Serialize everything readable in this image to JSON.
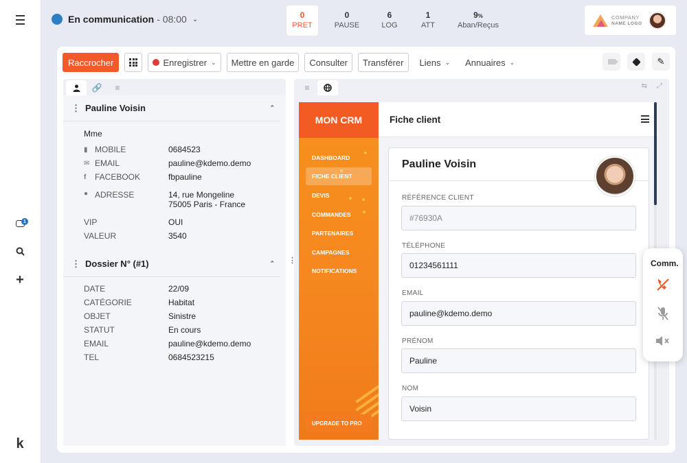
{
  "status": {
    "label": "En communication",
    "time": "- 08:00"
  },
  "counters": [
    {
      "num": "0",
      "label": "PRET"
    },
    {
      "num": "0",
      "label": "PAUSE"
    },
    {
      "num": "6",
      "label": "LOG"
    },
    {
      "num": "1",
      "label": "ATT"
    },
    {
      "num": "9",
      "pct": "%",
      "label": "Aban/Reçus"
    }
  ],
  "company": {
    "line1": "COMPANY",
    "line2": "NAME LOGO"
  },
  "rail": {
    "badge": "1",
    "logo": "k"
  },
  "toolbar": {
    "hangup": "Raccrocher",
    "record": "Enregistrer",
    "hold": "Mettre en garde",
    "consult": "Consulter",
    "transfer": "Transférer",
    "links": "Liens",
    "directories": "Annuaires"
  },
  "contact": {
    "name": "Pauline Voisin",
    "title": "Mme",
    "fields": [
      {
        "label": "MOBILE",
        "value": "0684523"
      },
      {
        "label": "EMAIL",
        "value": "pauline@kdemo.demo"
      },
      {
        "label": "FACEBOOK",
        "value": "fbpauline"
      },
      {
        "label": "ADRESSE",
        "value": "14, rue Mongeline",
        "value2": "75005 Paris - France"
      },
      {
        "label": "VIP",
        "value": "OUI"
      },
      {
        "label": "VALEUR",
        "value": "3540"
      }
    ]
  },
  "dossier": {
    "title": "Dossier N° (#1)",
    "fields": [
      {
        "label": "DATE",
        "value": "22/09"
      },
      {
        "label": "CATÉGORIE",
        "value": "Habitat"
      },
      {
        "label": "OBJET",
        "value": "Sinistre"
      },
      {
        "label": "STATUT",
        "value": "En cours"
      },
      {
        "label": "EMAIL",
        "value": "pauline@kdemo.demo"
      },
      {
        "label": "TEL",
        "value": "0684523215"
      }
    ]
  },
  "crm": {
    "brand": "MON CRM",
    "nav": [
      "DASHBOARD",
      "FICHE CLIENT",
      "DEVIS",
      "COMMANDES",
      "PARTENAIRES",
      "CAMPAGNES",
      "NOTIFICATIONS"
    ],
    "upgrade": "UPGRADE TO PRO",
    "page_title": "Fiche client",
    "client_name": "Pauline Voisin",
    "fields": [
      {
        "label": "RÉFÉRENCE CLIENT",
        "value": "#76930A"
      },
      {
        "label": "TÉLÉPHONE",
        "value": "01234561111"
      },
      {
        "label": "EMAIL",
        "value": "pauline@kdemo.demo"
      },
      {
        "label": "PRÉNOM",
        "value": "Pauline"
      },
      {
        "label": "NOM",
        "value": "Voisin"
      }
    ]
  },
  "comm": {
    "title": "Comm."
  },
  "colors": {
    "accent": "#f25a2a",
    "status_blue": "#2d7ec4",
    "crm_orange": "#f7911e"
  }
}
